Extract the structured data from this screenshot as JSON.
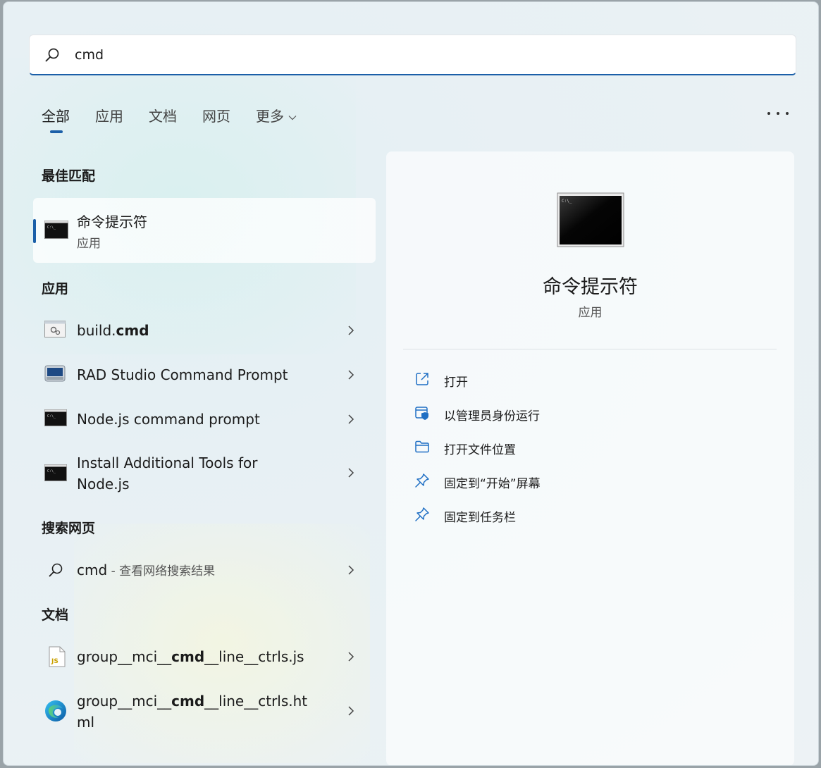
{
  "search": {
    "value": "cmd"
  },
  "tabs": [
    {
      "label": "全部"
    },
    {
      "label": "应用"
    },
    {
      "label": "文档"
    },
    {
      "label": "网页"
    },
    {
      "label": "更多"
    }
  ],
  "sections": {
    "best_match": "最佳匹配",
    "apps": "应用",
    "web": "搜索网页",
    "docs": "文档"
  },
  "best_match": {
    "name": "命令提示符",
    "type": "应用"
  },
  "apps": [
    {
      "pre": "build.",
      "bold": "cmd",
      "post": ""
    },
    {
      "pre": "RAD Studio Command Prompt",
      "bold": "",
      "post": ""
    },
    {
      "pre": "Node.js command prompt",
      "bold": "",
      "post": ""
    },
    {
      "line1": "Install Additional Tools for",
      "line2": "Node.js"
    }
  ],
  "web": {
    "query": "cmd",
    "suffix": " - 查看网络搜索结果"
  },
  "docs": [
    {
      "pre": "group__mci__",
      "bold": "cmd",
      "post": "__line__ctrls.js"
    },
    {
      "pre": "group__mci__",
      "bold": "cmd",
      "post": "__line__ctrls.ht",
      "line2": "ml"
    }
  ],
  "detail": {
    "title": "命令提示符",
    "type": "应用",
    "actions": [
      {
        "label": "打开",
        "icon": "open-external-icon"
      },
      {
        "label": "以管理员身份运行",
        "icon": "shield-icon"
      },
      {
        "label": "打开文件位置",
        "icon": "folder-icon"
      },
      {
        "label": "固定到“开始”屏幕",
        "icon": "pin-icon"
      },
      {
        "label": "固定到任务栏",
        "icon": "pin-icon"
      }
    ]
  },
  "colors": {
    "accent": "#1b5fa8",
    "icon_blue": "#1f6fc4"
  }
}
